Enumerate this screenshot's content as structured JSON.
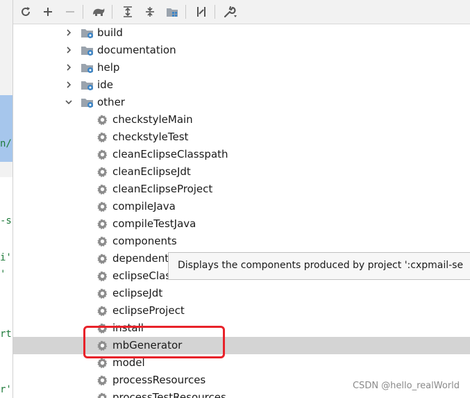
{
  "toolbar": {
    "buttons": [
      {
        "name": "refresh-icon"
      },
      {
        "name": "plus-icon"
      },
      {
        "name": "minus-icon"
      },
      {
        "name": "gradle-elephant-icon"
      },
      {
        "name": "expand-all-icon"
      },
      {
        "name": "collapse-all-icon"
      },
      {
        "name": "group-modules-icon"
      },
      {
        "name": "toggle-offline-icon"
      },
      {
        "name": "wrench-settings-icon"
      }
    ]
  },
  "editor_fragments": [
    "n/",
    "-s",
    "i'",
    "'",
    "rt",
    "r'"
  ],
  "tree": {
    "folders": [
      {
        "label": "build",
        "expanded": false
      },
      {
        "label": "documentation",
        "expanded": false
      },
      {
        "label": "help",
        "expanded": false
      },
      {
        "label": "ide",
        "expanded": false
      },
      {
        "label": "other",
        "expanded": true
      }
    ],
    "tasks": [
      {
        "label": "checkstyleMain"
      },
      {
        "label": "checkstyleTest"
      },
      {
        "label": "cleanEclipseClasspath"
      },
      {
        "label": "cleanEclipseJdt"
      },
      {
        "label": "cleanEclipseProject"
      },
      {
        "label": "compileJava"
      },
      {
        "label": "compileTestJava"
      },
      {
        "label": "components"
      },
      {
        "label": "dependent"
      },
      {
        "label": "eclipseClas"
      },
      {
        "label": "eclipseJdt"
      },
      {
        "label": "eclipseProject"
      },
      {
        "label": "install"
      },
      {
        "label": "mbGenerator",
        "selected": true
      },
      {
        "label": "model"
      },
      {
        "label": "processResources"
      },
      {
        "label": "processTestResources"
      }
    ]
  },
  "tooltip": {
    "text": "Displays the components produced by project ':cxpmail-se"
  },
  "watermark": "CSDN @hello_realWorld",
  "colors": {
    "annotation": "#e8222a",
    "selection": "#d4d4d4",
    "folder_blue": "#3d85c6",
    "gear_gray": "#8c8c8c"
  }
}
